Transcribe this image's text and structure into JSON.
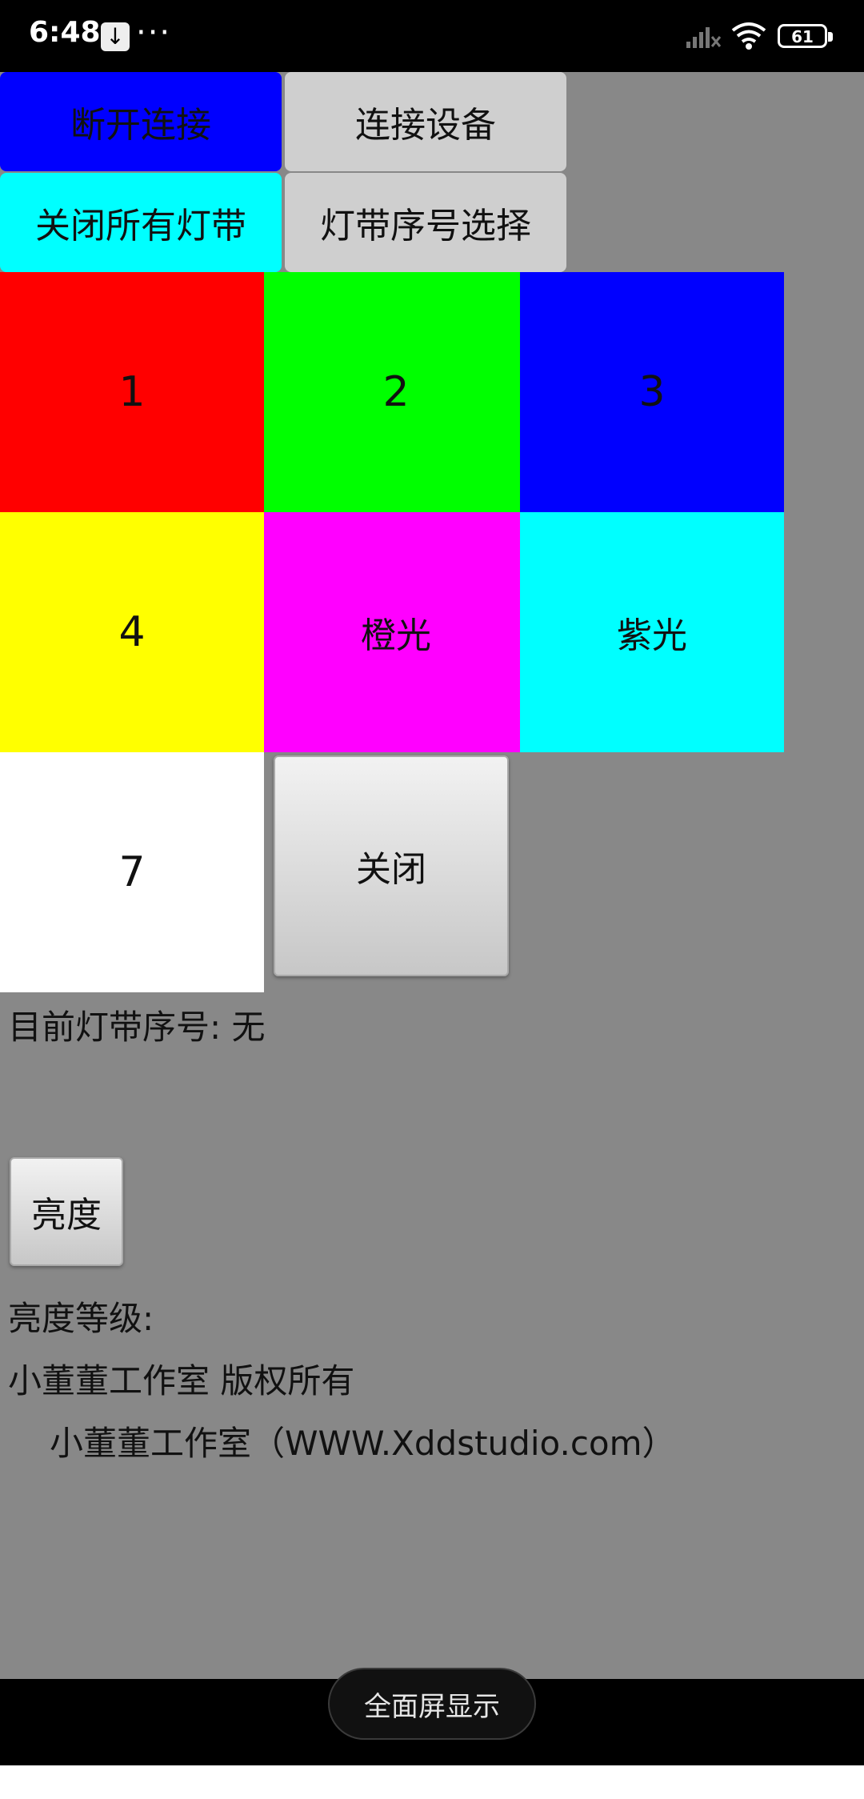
{
  "status_bar": {
    "time": "6:48",
    "download_icon": "download-icon",
    "more": "···",
    "battery": "61"
  },
  "controls": {
    "disconnect": "断开连接",
    "connect": "连接设备",
    "close_all": "关闭所有灯带",
    "select_index": "灯带序号选择"
  },
  "grid": [
    {
      "label": "1",
      "color": "#ff0000"
    },
    {
      "label": "2",
      "color": "#00ff00"
    },
    {
      "label": "3",
      "color": "#0000ff"
    },
    {
      "label": "4",
      "color": "#ffff00"
    },
    {
      "label": "橙光",
      "color": "#ff00ff"
    },
    {
      "label": "紫光",
      "color": "#00ffff"
    },
    {
      "label": "7",
      "color": "#ffffff"
    }
  ],
  "close_button": "关闭",
  "current_index_text": "目前灯带序号:  无",
  "brightness_button": "亮度",
  "brightness_level_text": "亮度等级:",
  "copyright": "小董董工作室 版权所有",
  "website": "小董董工作室（WWW.Xddstudio.com）",
  "navbar": {
    "fullscreen": "全面屏显示"
  },
  "colors": {
    "app_background": "#888888",
    "disconnect_button": "#0000ff",
    "close_all_button": "#00ffff",
    "gray_button": "#cfcfcf"
  }
}
